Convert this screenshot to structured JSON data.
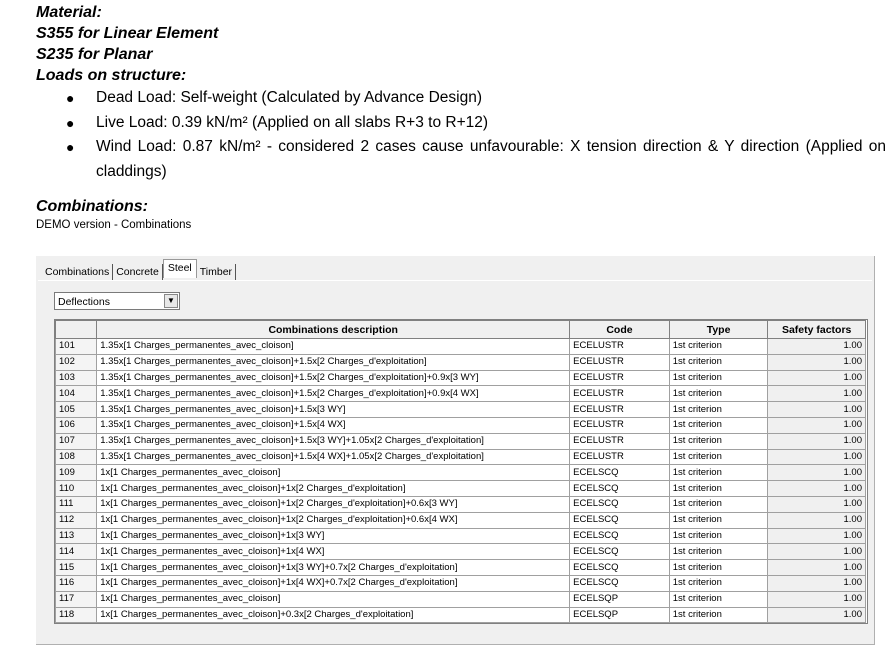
{
  "material": {
    "heading": "Material:",
    "lines": [
      "S355 for Linear Element",
      "S235 for Planar"
    ]
  },
  "loads": {
    "heading": "Loads on structure:",
    "items": [
      "Dead Load: Self-weight (Calculated by Advance Design)",
      "Live Load: 0.39 kN/m² (Applied on all slabs R+3 to R+12)",
      "Wind Load: 0.87 kN/m² - considered 2 cases cause unfavourable: X tension direction & Y direction (Applied on claddings)"
    ]
  },
  "combinations": {
    "heading": "Combinations:",
    "caption": "DEMO version - Combinations"
  },
  "dialog": {
    "tabs": [
      "Combinations",
      "Concrete",
      "Steel",
      "Timber"
    ],
    "active_tab": "Steel",
    "select_value": "Deflections",
    "columns": [
      "",
      "Combinations description",
      "Code",
      "Type",
      "Safety factors"
    ],
    "rows": [
      [
        "101",
        "1.35x[1 Charges_permanentes_avec_cloison]",
        "ECELUSTR",
        "1st criterion",
        "1.00"
      ],
      [
        "102",
        "1.35x[1 Charges_permanentes_avec_cloison]+1.5x[2 Charges_d'exploitation]",
        "ECELUSTR",
        "1st criterion",
        "1.00"
      ],
      [
        "103",
        "1.35x[1 Charges_permanentes_avec_cloison]+1.5x[2 Charges_d'exploitation]+0.9x[3 WY]",
        "ECELUSTR",
        "1st criterion",
        "1.00"
      ],
      [
        "104",
        "1.35x[1 Charges_permanentes_avec_cloison]+1.5x[2 Charges_d'exploitation]+0.9x[4 WX]",
        "ECELUSTR",
        "1st criterion",
        "1.00"
      ],
      [
        "105",
        "1.35x[1 Charges_permanentes_avec_cloison]+1.5x[3 WY]",
        "ECELUSTR",
        "1st criterion",
        "1.00"
      ],
      [
        "106",
        "1.35x[1 Charges_permanentes_avec_cloison]+1.5x[4 WX]",
        "ECELUSTR",
        "1st criterion",
        "1.00"
      ],
      [
        "107",
        "1.35x[1 Charges_permanentes_avec_cloison]+1.5x[3 WY]+1.05x[2 Charges_d'exploitation]",
        "ECELUSTR",
        "1st criterion",
        "1.00"
      ],
      [
        "108",
        "1.35x[1 Charges_permanentes_avec_cloison]+1.5x[4 WX]+1.05x[2 Charges_d'exploitation]",
        "ECELUSTR",
        "1st criterion",
        "1.00"
      ],
      [
        "109",
        "1x[1 Charges_permanentes_avec_cloison]",
        "ECELSCQ",
        "1st criterion",
        "1.00"
      ],
      [
        "110",
        "1x[1 Charges_permanentes_avec_cloison]+1x[2 Charges_d'exploitation]",
        "ECELSCQ",
        "1st criterion",
        "1.00"
      ],
      [
        "111",
        "1x[1 Charges_permanentes_avec_cloison]+1x[2 Charges_d'exploitation]+0.6x[3 WY]",
        "ECELSCQ",
        "1st criterion",
        "1.00"
      ],
      [
        "112",
        "1x[1 Charges_permanentes_avec_cloison]+1x[2 Charges_d'exploitation]+0.6x[4 WX]",
        "ECELSCQ",
        "1st criterion",
        "1.00"
      ],
      [
        "113",
        "1x[1 Charges_permanentes_avec_cloison]+1x[3 WY]",
        "ECELSCQ",
        "1st criterion",
        "1.00"
      ],
      [
        "114",
        "1x[1 Charges_permanentes_avec_cloison]+1x[4 WX]",
        "ECELSCQ",
        "1st criterion",
        "1.00"
      ],
      [
        "115",
        "1x[1 Charges_permanentes_avec_cloison]+1x[3 WY]+0.7x[2 Charges_d'exploitation]",
        "ECELSCQ",
        "1st criterion",
        "1.00"
      ],
      [
        "116",
        "1x[1 Charges_permanentes_avec_cloison]+1x[4 WX]+0.7x[2 Charges_d'exploitation]",
        "ECELSCQ",
        "1st criterion",
        "1.00"
      ],
      [
        "117",
        "1x[1 Charges_permanentes_avec_cloison]",
        "ECELSQP",
        "1st criterion",
        "1.00"
      ],
      [
        "118",
        "1x[1 Charges_permanentes_avec_cloison]+0.3x[2 Charges_d'exploitation]",
        "ECELSQP",
        "1st criterion",
        "1.00"
      ]
    ]
  }
}
